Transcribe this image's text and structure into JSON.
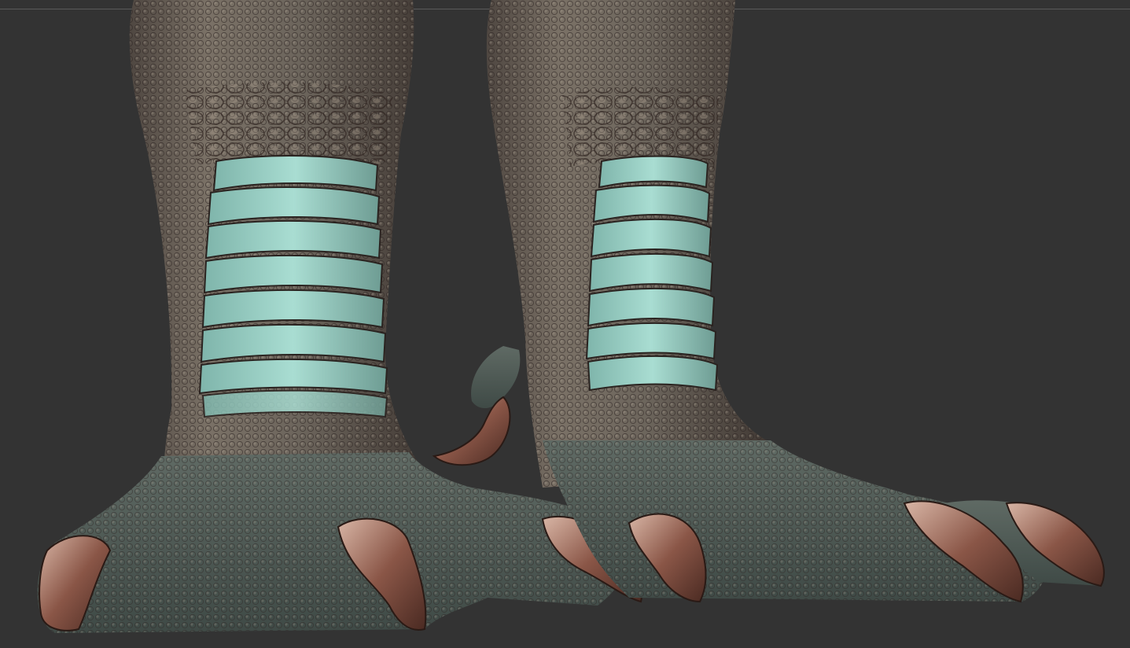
{
  "viewport": {
    "background": "#333333",
    "frame_line_color": "#5b5b5b"
  },
  "model": {
    "subject": "dinosaur-feet-sculpt",
    "material_colors": {
      "skin_base": "#6e6a62",
      "scale_highlight": "#8fc9bf",
      "scale_shadow": "#3a2b26",
      "claw": "#7a4a3c",
      "claw_highlight": "#d8b2a2"
    }
  }
}
